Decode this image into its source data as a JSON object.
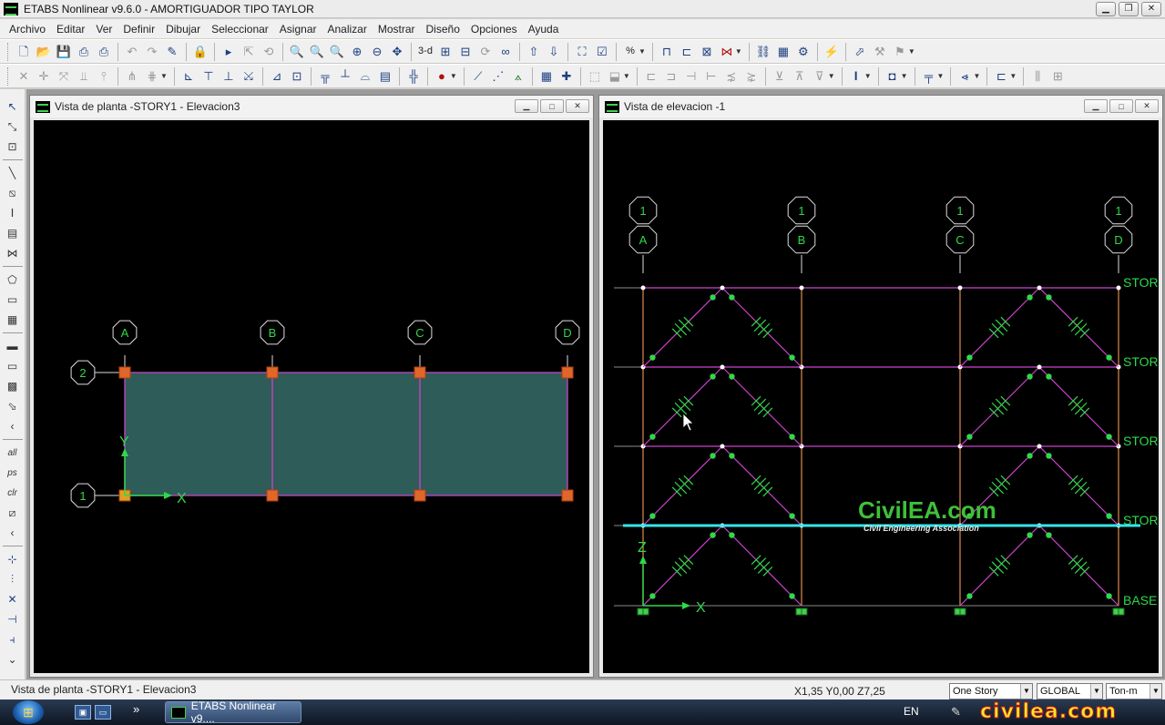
{
  "app": {
    "title": "ETABS Nonlinear v9.6.0 - AMORTIGUADOR TIPO TAYLOR",
    "window_buttons": [
      "minimize",
      "restore",
      "close"
    ]
  },
  "menu": [
    "Archivo",
    "Editar",
    "Ver",
    "Definir",
    "Dibujar",
    "Seleccionar",
    "Asignar",
    "Analizar",
    "Mostrar",
    "Diseño",
    "Opciones",
    "Ayuda"
  ],
  "toolbar": {
    "view_3d_label": "3-d",
    "percent_label": "%",
    "lightning_icon": "run-analysis-icon"
  },
  "left_tools": {
    "all_label": "all",
    "ps_label": "ps",
    "clr_label": "clr"
  },
  "plan_window": {
    "title": "Vista de planta -STORY1 - Elevacion3",
    "grid_x_labels": [
      "A",
      "B",
      "C",
      "D"
    ],
    "grid_y_labels": [
      "2",
      "1"
    ],
    "axis_x_label": "X",
    "axis_y_label": "Y",
    "colors": {
      "line": "#cc44cc",
      "slab": "#2e5c58",
      "joint": "#e0662a",
      "label": "#2fd94a"
    }
  },
  "elevation_window": {
    "title": "Vista de elevacion -1",
    "grid_top_labels": [
      "1",
      "1",
      "1",
      "1"
    ],
    "grid_labels": [
      "A",
      "B",
      "C",
      "D"
    ],
    "story_labels": [
      "STOR",
      "STOR",
      "STOR",
      "STOR",
      "BASE"
    ],
    "axis_x_label": "X",
    "axis_z_label": "Z",
    "colors": {
      "beam": "#cc44cc",
      "column": "#e28a50",
      "brace": "#cc44cc",
      "damper": "#2fd94a",
      "highlight": "#35e6ea"
    }
  },
  "watermark": {
    "main": "CivilEA.com",
    "sub": "Civil Engineering Association",
    "tray": "civilea.com"
  },
  "status": {
    "left_text": "Vista de planta -STORY1 - Elevacion3",
    "coords": "X1,35  Y0,00  Z7,25",
    "story_select": "One Story",
    "coord_system": "GLOBAL",
    "units": "Ton-m"
  },
  "taskbar": {
    "app_button": "ETABS Nonlinear v9....",
    "language": "EN"
  }
}
